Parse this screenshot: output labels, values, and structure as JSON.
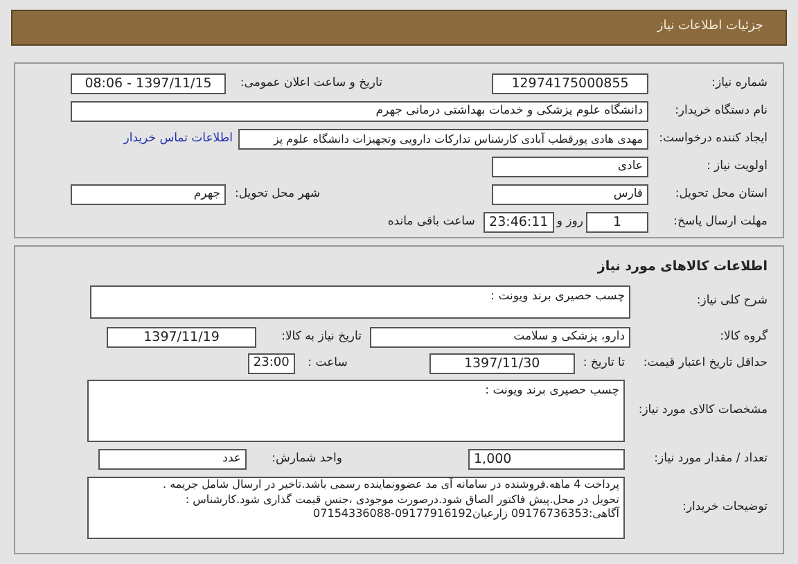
{
  "header": {
    "title": "جزئیات اطلاعات نیاز"
  },
  "need": {
    "need_number_label": "شماره نیاز:",
    "need_number": "12974175000855",
    "announce_label": "تاریخ و ساعت اعلان عمومی:",
    "announce": "1397/11/15 - 08:06",
    "buyer_label": "نام دستگاه خریدار:",
    "buyer": "دانشگاه علوم پزشکی و خدمات بهداشتی درمانی جهرم",
    "creator_label": "ایجاد کننده درخواست:",
    "creator": "مهدی هادی پورقطب آبادی کارشناس تدارکات دارویی وتجهیزات دانشگاه علوم پز",
    "contact_link": "اطلاعات تماس خریدار",
    "priority_label": "اولویت نیاز :",
    "priority": "عادی",
    "province_label": "استان محل تحویل:",
    "province": "فارس",
    "city_label": "شهر محل تحویل:",
    "city": "جهرم",
    "deadline_label": "مهلت ارسال پاسخ:",
    "days": "1",
    "days_unit": "روز و",
    "time_left": "23:46:11",
    "time_left_label": "ساعت باقی مانده"
  },
  "goods": {
    "title": "اطلاعات کالاهای مورد نیاز",
    "description_label": "شرح کلی نیاز:",
    "description": "چسب حصیری برند ویونت :",
    "group_label": "گروه کالا:",
    "group": "دارو، پزشکی و سلامت",
    "need_date_label": "تاریخ نیاز به کالا:",
    "need_date": "1397/11/19",
    "validity_label": "حداقل تاریخ اعتبار قیمت:",
    "until_label": "تا تاریخ :",
    "until_date": "1397/11/30",
    "hour_label": "ساعت :",
    "hour": "23:00",
    "specs_label": "مشخصات کالای مورد نیاز:",
    "specs": "چسب حصیری برند ویونت :",
    "quantity_label": "تعداد / مقدار مورد نیاز:",
    "quantity": "1,000",
    "unit_label": "واحد شمارش:",
    "unit": "عدد",
    "notes_label": "توضیحات خریدار:",
    "notes": [
      "پرداخت 4 ماهه.فروشنده در سامانه آی مد عضوونماینده رسمی باشد.تاخیر در ارسال شامل جریمه .",
      "تحویل در محل.پیش فاکتور الصاق شود.درصورت موجودی ،جنس قیمت گذاری شود.کارشناس :",
      "آگاهی:09176736353 زارعیان09177916192-07154336088"
    ]
  }
}
